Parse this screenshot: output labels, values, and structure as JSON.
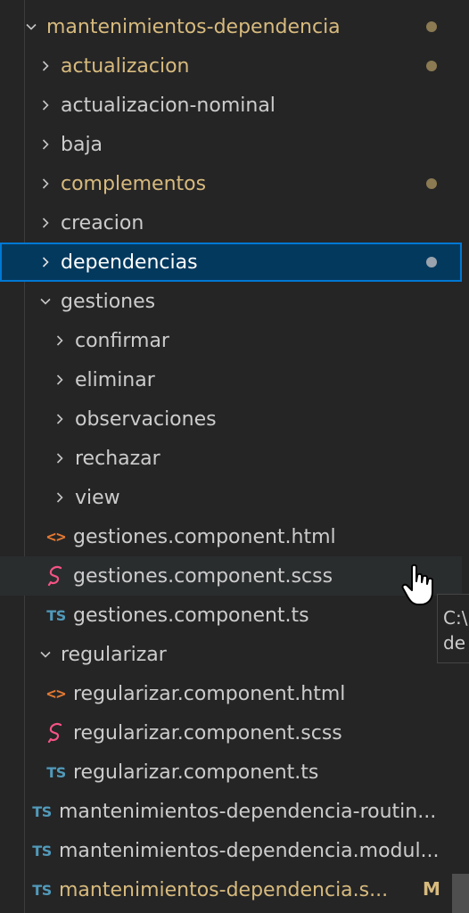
{
  "colors": {
    "modified": "#d7ba7d",
    "selected_background": "#04395e",
    "selected_border": "#0078d4",
    "ts_icon": "#519aba",
    "html_icon": "#e37933",
    "scss_icon": "#f55385"
  },
  "tree": {
    "items": [
      {
        "label": "mantenimientos-dependencia",
        "kind": "folder-expanded",
        "status": "modified"
      },
      {
        "label": "actualizacion",
        "kind": "folder-collapsed",
        "status": "modified"
      },
      {
        "label": "actualizacion-nominal",
        "kind": "folder-collapsed"
      },
      {
        "label": "baja",
        "kind": "folder-collapsed"
      },
      {
        "label": "complementos",
        "kind": "folder-collapsed",
        "status": "modified"
      },
      {
        "label": "creacion",
        "kind": "folder-collapsed"
      },
      {
        "label": "dependencias",
        "kind": "folder-collapsed",
        "selected": true
      },
      {
        "label": "gestiones",
        "kind": "folder-expanded"
      },
      {
        "label": "confirmar",
        "kind": "folder-collapsed"
      },
      {
        "label": "eliminar",
        "kind": "folder-collapsed"
      },
      {
        "label": "observaciones",
        "kind": "folder-collapsed"
      },
      {
        "label": "rechazar",
        "kind": "folder-collapsed"
      },
      {
        "label": "view",
        "kind": "folder-collapsed"
      },
      {
        "label": "gestiones.component.html",
        "kind": "file-html",
        "icon": "html-file-icon"
      },
      {
        "label": "gestiones.component.scss",
        "kind": "file-scss",
        "icon": "sass-file-icon",
        "hovered": true
      },
      {
        "label": "gestiones.component.ts",
        "kind": "file-ts",
        "icon": "typescript-file-icon",
        "icon_text": "TS"
      },
      {
        "label": "regularizar",
        "kind": "folder-expanded"
      },
      {
        "label": "regularizar.component.html",
        "kind": "file-html",
        "icon": "html-file-icon"
      },
      {
        "label": "regularizar.component.scss",
        "kind": "file-scss",
        "icon": "sass-file-icon"
      },
      {
        "label": "regularizar.component.ts",
        "kind": "file-ts",
        "icon": "typescript-file-icon",
        "icon_text": "TS"
      },
      {
        "label": "mantenimientos-dependencia-routin...",
        "kind": "file-ts",
        "icon": "typescript-file-icon",
        "icon_text": "TS"
      },
      {
        "label": "mantenimientos-dependencia.modul...",
        "kind": "file-ts",
        "icon": "typescript-file-icon",
        "icon_text": "TS"
      },
      {
        "label": "mantenimientos-dependencia.s...",
        "kind": "file-ts",
        "icon": "typescript-file-icon",
        "icon_text": "TS",
        "status": "modified",
        "badge": "M"
      }
    ]
  },
  "tooltip": {
    "line1": "C:\\",
    "line2": "de"
  }
}
